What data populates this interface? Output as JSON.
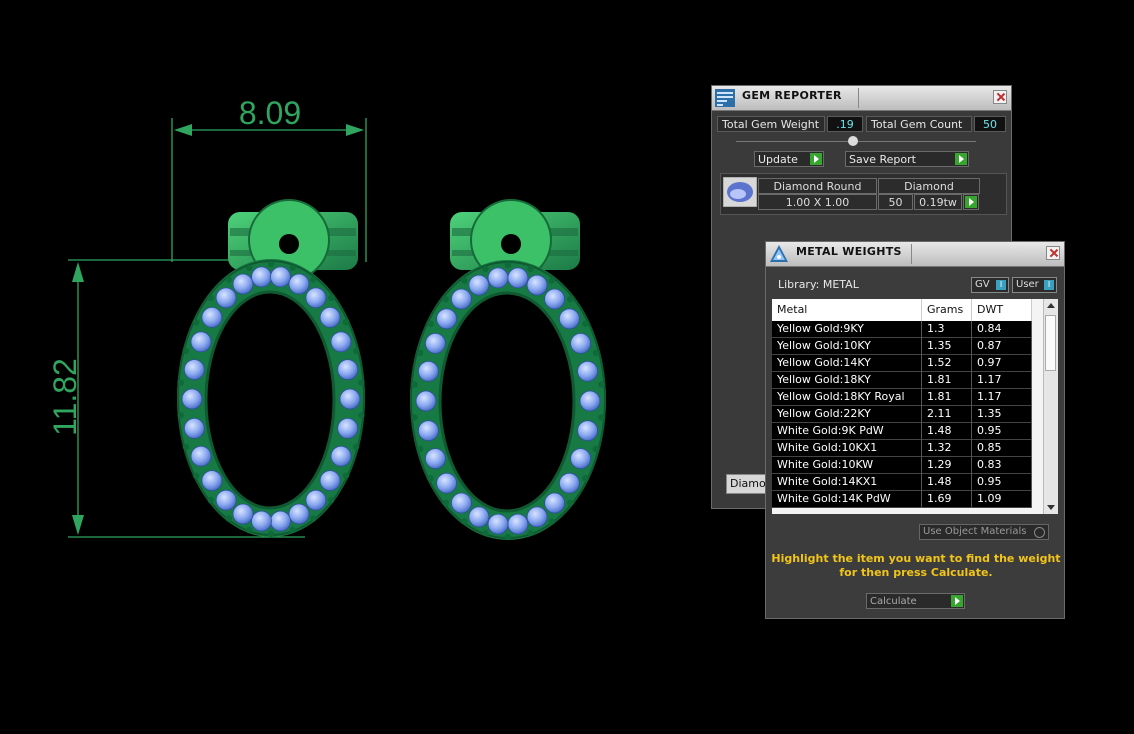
{
  "viewport": {
    "width_dim": "8.09",
    "height_dim": "11.82"
  },
  "gem_reporter": {
    "title": "GEM REPORTER",
    "total_gem_weight_label": "Total Gem Weight",
    "total_gem_weight": ".19",
    "total_gem_count_label": "Total Gem Count",
    "total_gem_count": "50",
    "update_label": "Update",
    "save_report_label": "Save Report",
    "gem": {
      "shape": "Diamond Round",
      "size": "1.00 X 1.00",
      "type": "Diamond",
      "count": "50",
      "weight": "0.19tw"
    },
    "bottom_tab": "Diamon"
  },
  "metal_weights": {
    "title": "METAL WEIGHTS",
    "library_label": "Library: METAL",
    "gv_label": "GV",
    "user_label": "User",
    "columns": [
      "Metal",
      "Grams",
      "DWT"
    ],
    "rows": [
      {
        "metal": "Yellow Gold:9KY",
        "grams": "1.3",
        "dwt": "0.84"
      },
      {
        "metal": "Yellow Gold:10KY",
        "grams": "1.35",
        "dwt": "0.87"
      },
      {
        "metal": "Yellow Gold:14KY",
        "grams": "1.52",
        "dwt": "0.97"
      },
      {
        "metal": "Yellow Gold:18KY",
        "grams": "1.81",
        "dwt": "1.17"
      },
      {
        "metal": "Yellow Gold:18KY Royal",
        "grams": "1.81",
        "dwt": "1.17"
      },
      {
        "metal": "Yellow Gold:22KY",
        "grams": "2.11",
        "dwt": "1.35"
      },
      {
        "metal": "White Gold:9K PdW",
        "grams": "1.48",
        "dwt": "0.95"
      },
      {
        "metal": "White Gold:10KX1",
        "grams": "1.32",
        "dwt": "0.85"
      },
      {
        "metal": "White Gold:10KW",
        "grams": "1.29",
        "dwt": "0.83"
      },
      {
        "metal": "White Gold:14KX1",
        "grams": "1.48",
        "dwt": "0.95"
      },
      {
        "metal": "White Gold:14K PdW",
        "grams": "1.69",
        "dwt": "1.09"
      }
    ],
    "use_object_materials": "Use Object Materials",
    "instruction_line1": "Highlight the item you want to find the weight",
    "instruction_line2": "for then press Calculate.",
    "calculate_label": "Calculate"
  }
}
